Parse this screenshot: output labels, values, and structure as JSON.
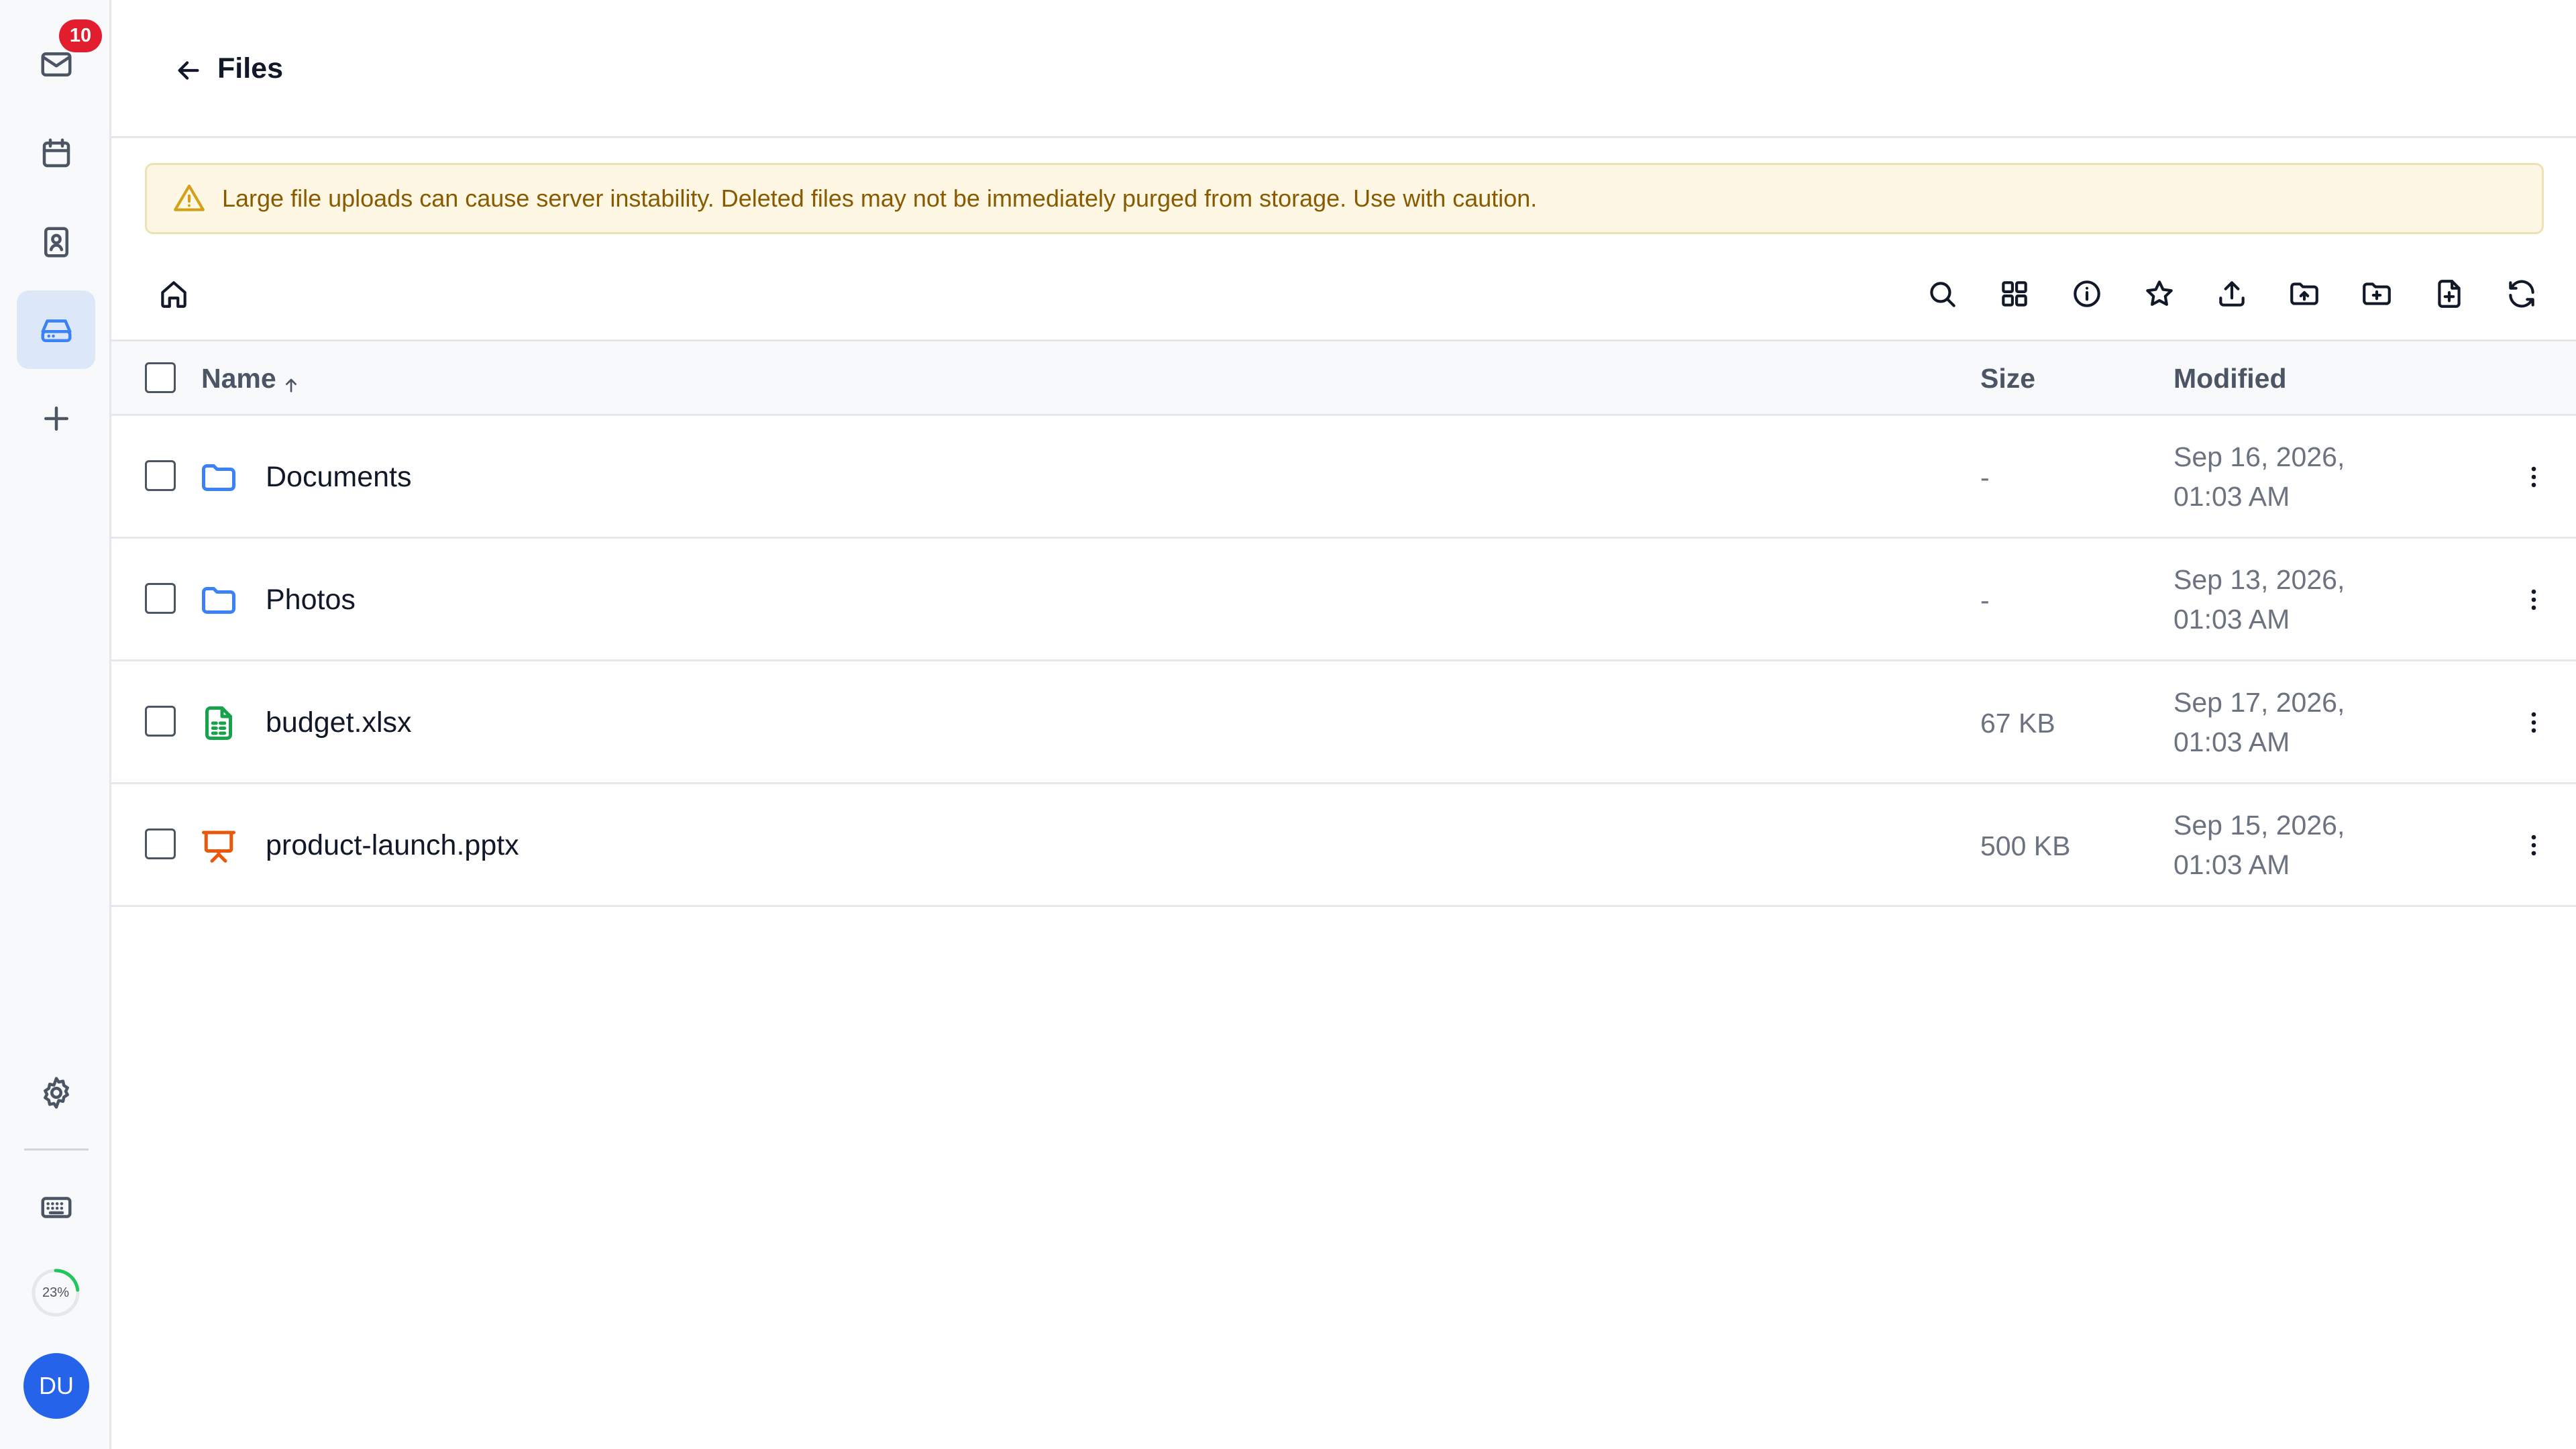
{
  "sidebar": {
    "mail_badge": "10",
    "items": [
      {
        "name": "mail-icon"
      },
      {
        "name": "calendar-icon"
      },
      {
        "name": "contacts-icon"
      },
      {
        "name": "drive-icon",
        "active": true
      },
      {
        "name": "plus-icon"
      }
    ],
    "storage_quota": {
      "label": "23%",
      "value": 0.23
    },
    "user_initials": "DU"
  },
  "header": {
    "title": "Files"
  },
  "banner": {
    "icon": "warning-icon",
    "text": "Large file uploads can cause server instability. Deleted files may not be immediately purged from storage. Use with caution."
  },
  "toolbar": {
    "icons": [
      "home-icon",
      "search-icon",
      "grid-view-icon",
      "info-icon",
      "star-icon",
      "upload-icon",
      "upload-folder-icon",
      "new-folder-icon",
      "new-file-icon",
      "refresh-icon"
    ]
  },
  "table": {
    "columns": {
      "name": "Name",
      "size": "Size",
      "modified": "Modified"
    },
    "rows": [
      {
        "name": "Documents",
        "type": "folder",
        "size": "-",
        "modified": "Sep 16, 2026, 01:03 AM"
      },
      {
        "name": "Photos",
        "type": "folder",
        "size": "-",
        "modified": "Sep 13, 2026, 01:03 AM"
      },
      {
        "name": "budget.xlsx",
        "type": "spreadsheet",
        "size": "67 KB",
        "modified": "Sep 17, 2026, 01:03 AM"
      },
      {
        "name": "product-launch.pptx",
        "type": "presentation",
        "size": "500 KB",
        "modified": "Sep 15, 2026, 01:03 AM"
      }
    ]
  },
  "colors": {
    "accent": "#3b82f6",
    "warning_bg": "#fdf7e3",
    "warning_text": "#8a5a00",
    "badge": "#e11d2e",
    "folder": "#3b82f6",
    "spreadsheet": "#16a34a",
    "presentation": "#ea580c",
    "quota": "#22c55e"
  }
}
